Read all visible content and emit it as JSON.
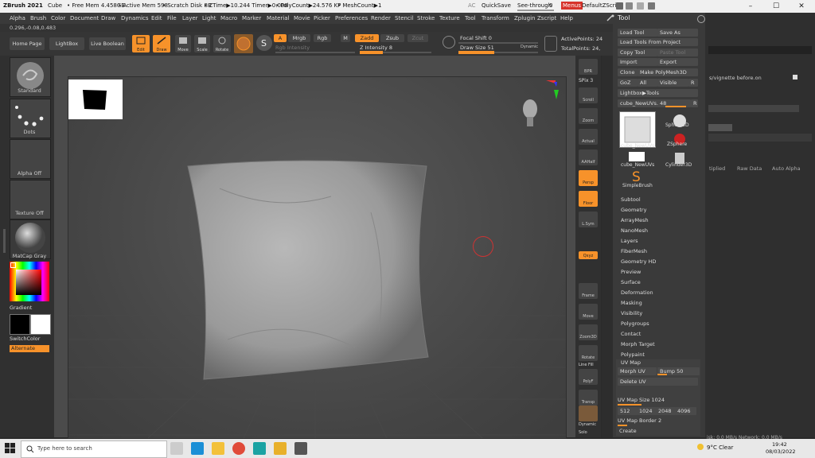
{
  "titlebar": {
    "app": "ZBrush 2021",
    "tool": "Cube",
    "free_mem": "• Free Mem 4.458GB",
    "active_mem": "• Active Mem 598",
    "scratch_disk": "• Scratch Disk 88",
    "ztime": "• ZTime▶10.244 Timer▶0.008",
    "polycount": "• PolyCount▶24.576 KP",
    "meshcount": "• MeshCount▶1",
    "ac": "AC",
    "quicksave": "QuickSave",
    "see_through": "See-through",
    "see_through_value": "0",
    "menus": "Menus",
    "default_zscript": "DefaultZScript",
    "minimize": "–",
    "maximize": "☐",
    "close": "✕"
  },
  "menubar": {
    "items": [
      "Alpha",
      "Brush",
      "Color",
      "Document",
      "Draw",
      "Dynamics",
      "Edit",
      "File",
      "Layer",
      "Light",
      "Macro",
      "Marker",
      "Material",
      "Movie",
      "Picker",
      "Preferences",
      "Render",
      "Stencil",
      "Stroke",
      "Texture",
      "Tool",
      "Transform",
      "Zplugin",
      "Zscript",
      "Help"
    ]
  },
  "infobar": {
    "coords": "0.296,-0.08,0.483"
  },
  "toolbar": {
    "home_page": "Home Page",
    "lightbox": "LightBox",
    "live_boolean": "Live Boolean",
    "edit": "Edit",
    "draw": "Draw",
    "move": "Move",
    "scale": "Scale",
    "rotate": "Rotate",
    "a": "A",
    "mrgb": "Mrgb",
    "rgb": "Rgb",
    "m": "M",
    "zadd": "Zadd",
    "zsub": "Zsub",
    "zcut": "Zcut",
    "rgb_intensity": "Rgb Intensity",
    "z_intensity": "Z Intensity 8",
    "z_intensity_value": 0.32,
    "focal_shift": "Focal Shift 0",
    "draw_size": "Draw Size 51",
    "draw_size_value": 0.45,
    "dynamic": "Dynamic",
    "active_points": "ActivePoints: 24",
    "total_points": "TotalPoints: 24,"
  },
  "leftshelf": {
    "standard": "Standard",
    "dots": "Dots",
    "alpha_off": "Alpha Off",
    "texture_off": "Texture Off",
    "matcap_gray": "MatCap Gray",
    "gradient": "Gradient",
    "switchcolor": "SwitchColor",
    "alternate": "Alternate"
  },
  "rightshelf": {
    "bpr": "BPR",
    "spix": "SPix 3",
    "scroll": "Scroll",
    "zoom": "Zoom",
    "actual": "Actual",
    "aahalf": "AAHalf",
    "persp": "Persp",
    "floor": "Floor",
    "lsym": "L.Sym",
    "qxyz": "Qxyz",
    "frame": "Frame",
    "move": "Move",
    "zoom3d": "Zoom3D",
    "rotate": "Rotate",
    "line_fill": "Line Fill",
    "polyf": "PolyF",
    "transp": "Transp",
    "ghost": "Ghost",
    "dynamic": "Dynamic",
    "solo": "Solo"
  },
  "toolpalette": {
    "title": "Tool",
    "load_tool": "Load Tool",
    "save_as": "Save As",
    "load_tools_from_project": "Load Tools From Project",
    "copy_tool": "Copy Tool",
    "paste_tool": "Paste Tool",
    "import": "Import",
    "export": "Export",
    "clone": "Clone",
    "make_polymesh": "Make PolyMesh3D",
    "goz": "GoZ",
    "all": "All",
    "visible": "Visible",
    "r": "R",
    "lightbox_tools": "Lightbox▶Tools",
    "cube_newuvs_slider": "cube_NewUVs. 48",
    "sphere3d": "Sphere3D",
    "cube_newuvs": "cube_NewUVs.",
    "zsphere": "ZSphere",
    "cube_newuvs2": "cube_NewUVs",
    "cylinder3d": "Cylinder3D",
    "simplebrush": "SimpleBrush",
    "sections": [
      "Subtool",
      "Geometry",
      "ArrayMesh",
      "NanoMesh",
      "Layers",
      "FiberMesh",
      "Geometry HD",
      "Preview",
      "Surface",
      "Deformation",
      "Masking",
      "Visibility",
      "Polygroups",
      "Contact",
      "Morph Target",
      "Polypaint"
    ],
    "uv_map": "UV Map",
    "morph_uv": "Morph UV",
    "bump": "Bump",
    "bump_value": "50",
    "delete_uv": "Delete UV",
    "uv_map_size": "UV Map Size",
    "uv_map_size_value": "1024",
    "sizes": [
      "512",
      "1024",
      "2048",
      "4096"
    ],
    "uv_map_border": "UV Map Border",
    "uv_map_border_value": "2",
    "create": "Create"
  },
  "farright": {
    "path": "s/vignette before.on",
    "tiplied": "tiplied",
    "raw_data": "Raw Data",
    "auto_alpha": "Auto Alpha",
    "disk_net": "isk: 0.0 MB/s Network: 0.0 MB/s"
  },
  "taskbar": {
    "search_placeholder": "Type here to search",
    "weather": "9°C  Clear",
    "time": "19:42",
    "date": "08/03/2022"
  },
  "colors": {
    "accent": "#f7922a"
  }
}
